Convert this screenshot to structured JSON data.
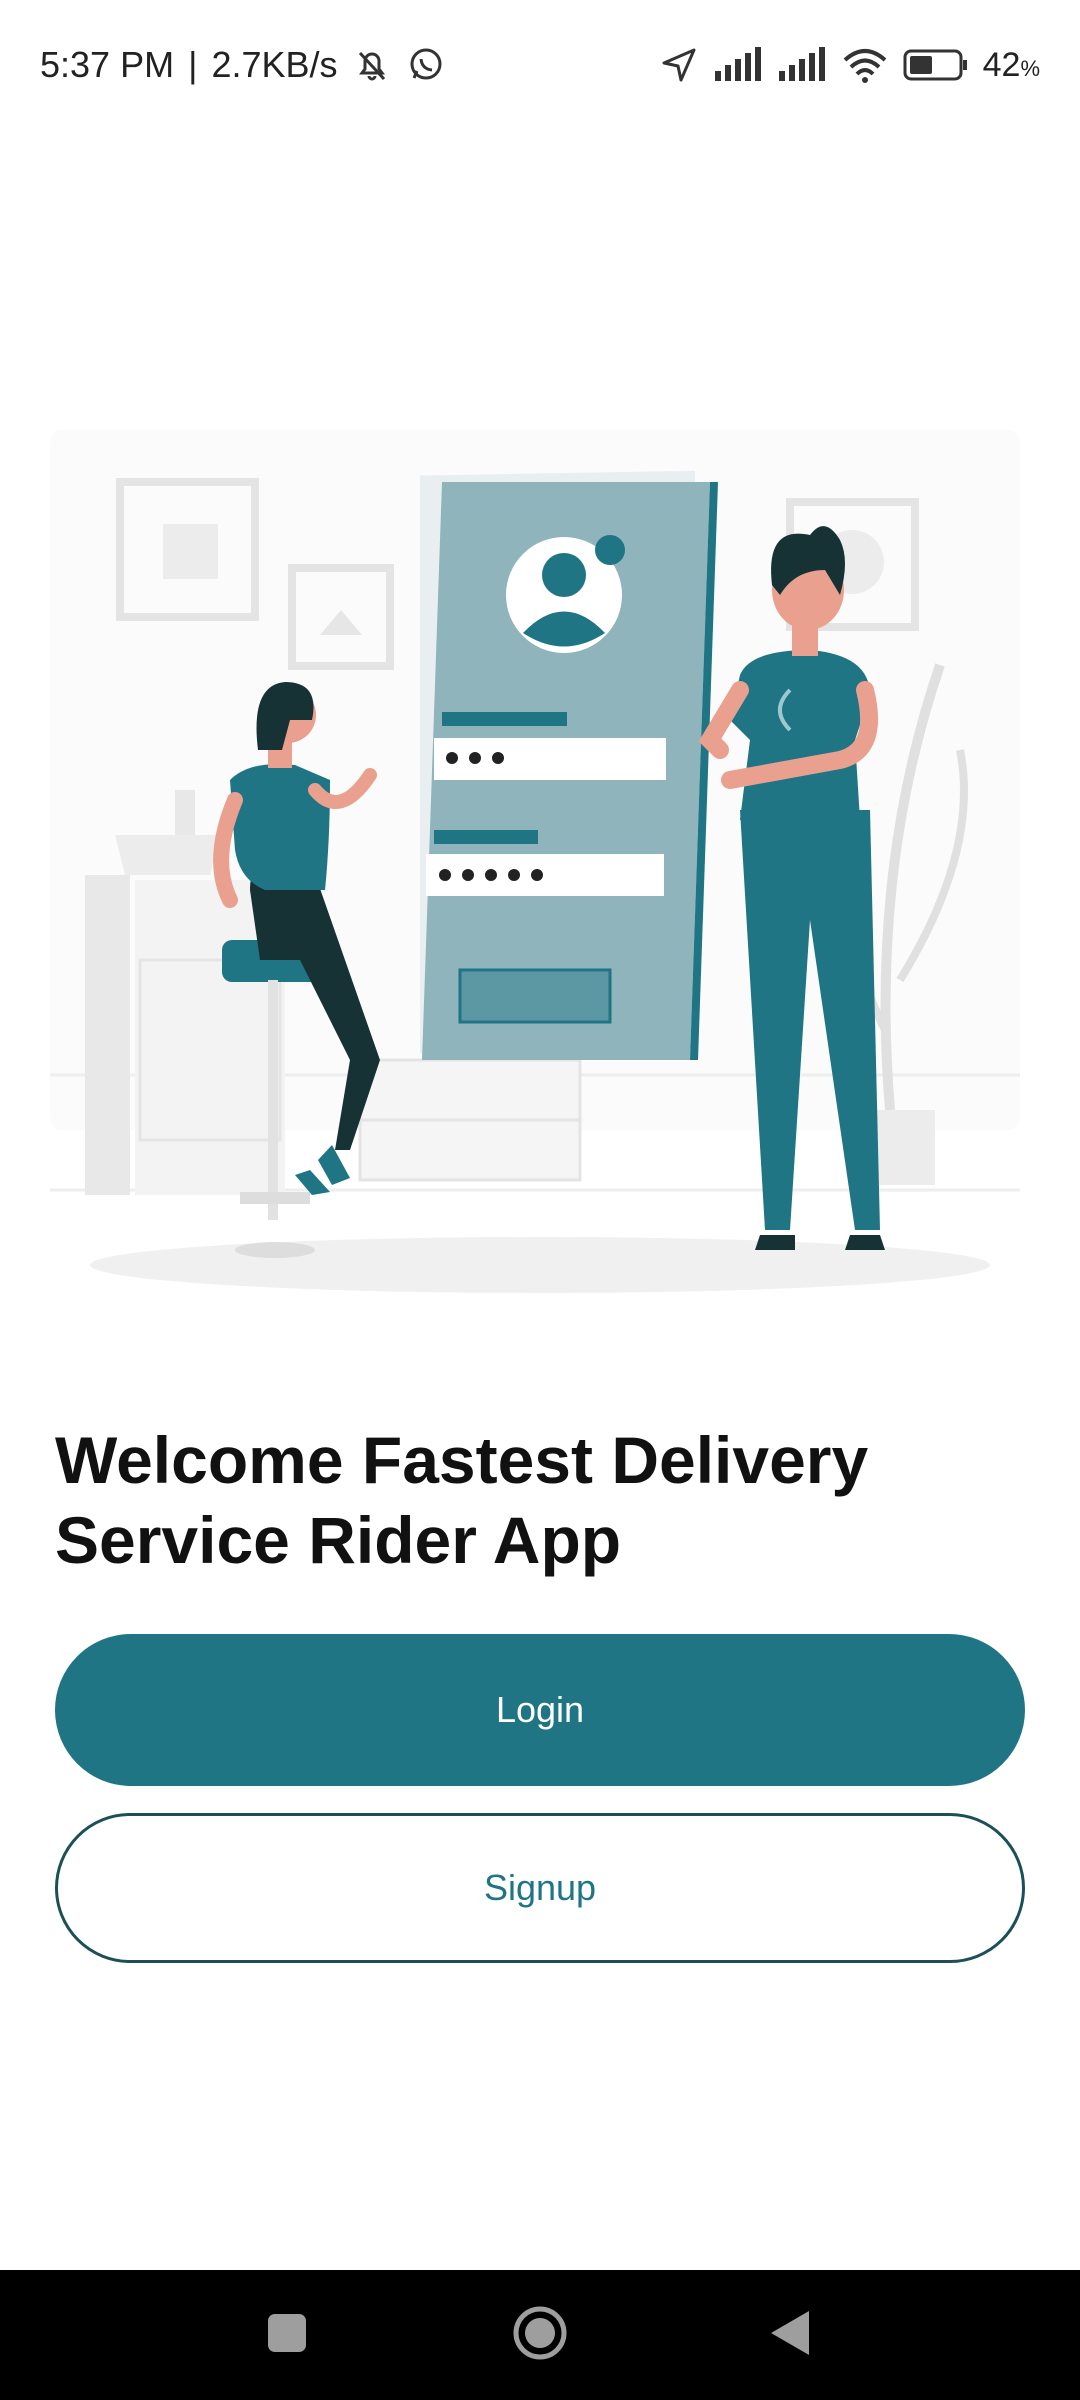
{
  "status_bar": {
    "time": "5:37 PM",
    "speed": "2.7KB/s",
    "battery_percent": "42",
    "battery_unit": "%",
    "icons": [
      "mute-bell-icon",
      "whatsapp-icon",
      "location-arrow-icon",
      "signal-icon",
      "signal-icon",
      "wifi-icon",
      "battery-icon"
    ]
  },
  "welcome": {
    "title_line1": "Welcome Fastest Delivery",
    "title_line2": "Service Rider App"
  },
  "buttons": {
    "login_label": "Login",
    "signup_label": "Signup"
  },
  "colors": {
    "accent": "#1f7584",
    "signup_border": "#1d4f58",
    "nav_bar": "#000000"
  },
  "nav_bar": {
    "icons": [
      "recent-apps-icon",
      "home-icon",
      "back-icon"
    ]
  }
}
